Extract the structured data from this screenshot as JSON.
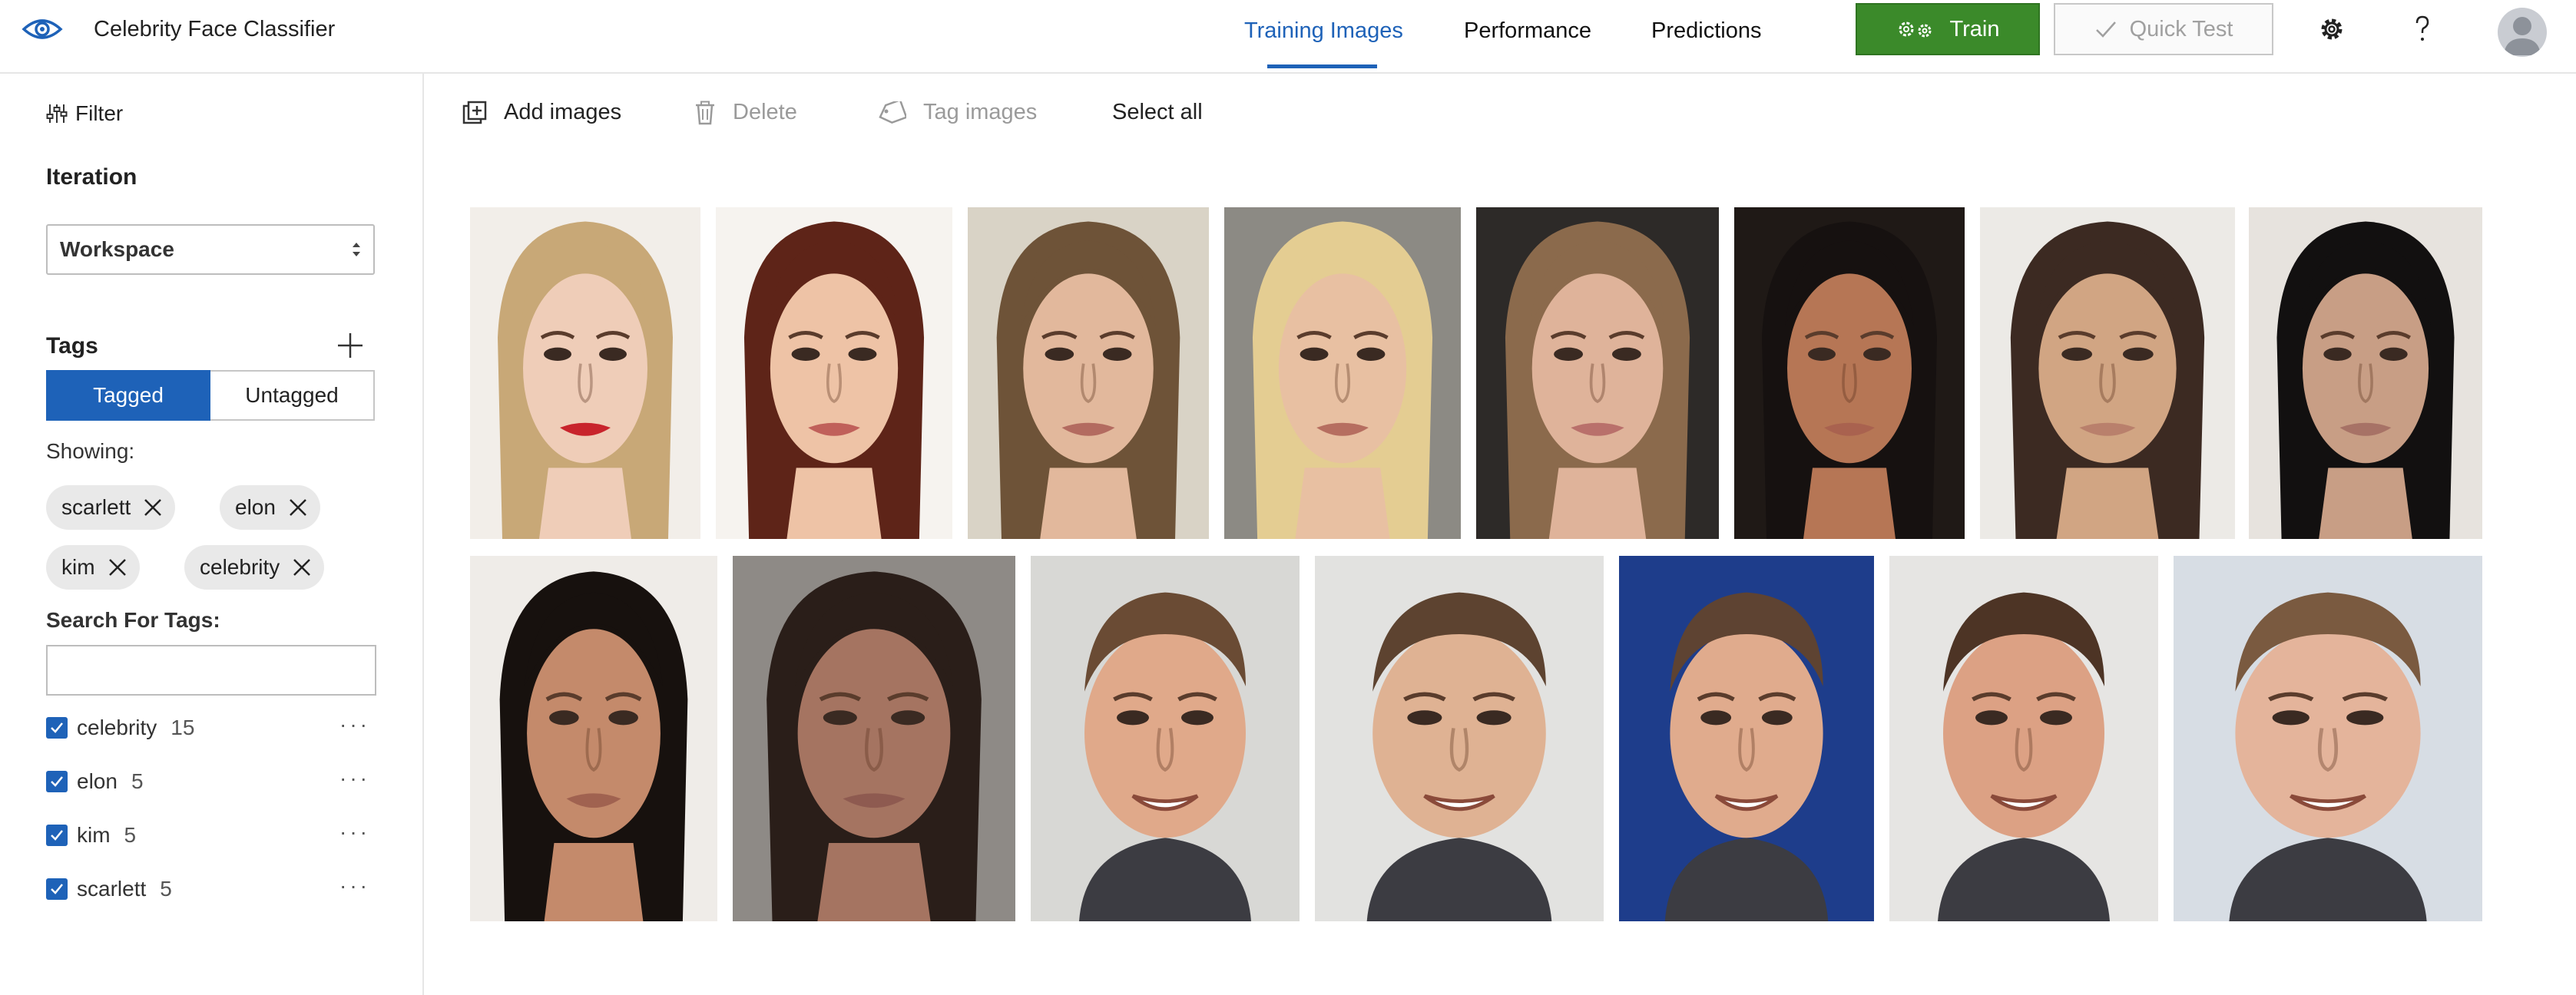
{
  "app": {
    "title": "Celebrity Face Classifier"
  },
  "nav": {
    "tabs": [
      {
        "label": "Training Images",
        "active": true
      },
      {
        "label": "Performance",
        "active": false
      },
      {
        "label": "Predictions",
        "active": false
      }
    ],
    "train_label": "Train",
    "quick_test_label": "Quick Test",
    "icons": [
      "eye-logo-icon",
      "gear-icon",
      "help-icon",
      "avatar"
    ]
  },
  "sidebar": {
    "filter_label": "Filter",
    "iteration_title": "Iteration",
    "iteration_value": "Workspace",
    "tags_title": "Tags",
    "tagged_label": "Tagged",
    "untagged_label": "Untagged",
    "showing_label": "Showing:",
    "chips": [
      "scarlett",
      "elon",
      "kim",
      "celebrity"
    ],
    "search_label": "Search For Tags:",
    "search_value": "",
    "tag_list": [
      {
        "name": "celebrity",
        "count": "15",
        "checked": true
      },
      {
        "name": "elon",
        "count": "5",
        "checked": true
      },
      {
        "name": "kim",
        "count": "5",
        "checked": true
      },
      {
        "name": "scarlett",
        "count": "5",
        "checked": true
      }
    ],
    "more_glyph": "···"
  },
  "toolbar": {
    "add_images": "Add images",
    "delete": "Delete",
    "tag_images": "Tag images",
    "select_all": "Select all"
  },
  "colors": {
    "accent": "#1e62b8",
    "train_green": "#3b8a2a"
  },
  "images": [
    {
      "name": "scarlett-1",
      "bg": "#f2eee9",
      "skin": "#efcdb8",
      "hair": "#c8a877",
      "lips": "#c8242c"
    },
    {
      "name": "scarlett-2",
      "bg": "#f6f3ef",
      "skin": "#eec3a6",
      "hair": "#5e2418",
      "lips": "#c0605a"
    },
    {
      "name": "scarlett-3",
      "bg": "#d9d3c6",
      "skin": "#e2b89c",
      "hair": "#6e5338",
      "lips": "#b36b60"
    },
    {
      "name": "scarlett-4",
      "bg": "#8c8a84",
      "skin": "#e8c0a2",
      "hair": "#e4cd92",
      "lips": "#b66e60"
    },
    {
      "name": "scarlett-5",
      "bg": "#2d2a28",
      "skin": "#dfb39a",
      "hair": "#8b6a4c",
      "lips": "#b9706b"
    },
    {
      "name": "kim-1",
      "bg": "#1f1916",
      "skin": "#b67655",
      "hair": "#161110",
      "lips": "#a9624f"
    },
    {
      "name": "kim-2",
      "bg": "#eceae6",
      "skin": "#d1a583",
      "hair": "#3c2a22",
      "lips": "#b9806c"
    },
    {
      "name": "kim-3",
      "bg": "#e7e3de",
      "skin": "#c89e85",
      "hair": "#121010",
      "lips": "#a77266"
    },
    {
      "name": "kim-4",
      "bg": "#efece8",
      "skin": "#c48a6b",
      "hair": "#17110e",
      "lips": "#a06250"
    },
    {
      "name": "kim-5",
      "bg": "#8e8a86",
      "skin": "#a57461",
      "hair": "#2a1e19",
      "lips": "#8e5a50"
    },
    {
      "name": "elon-1",
      "bg": "#d8d8d5",
      "skin": "#e0a98a",
      "hair": "#6a4b34",
      "lips": "#ffffff"
    },
    {
      "name": "elon-2",
      "bg": "#e2e2e0",
      "skin": "#dfb293",
      "hair": "#5d4330",
      "lips": "#ffffff"
    },
    {
      "name": "elon-3",
      "bg": "#1e3d8b",
      "skin": "#e0ab8d",
      "hair": "#5e4332",
      "lips": "#ffffff"
    },
    {
      "name": "elon-4",
      "bg": "#e6e5e3",
      "skin": "#dca184",
      "hair": "#4d3425",
      "lips": "#ffffff"
    },
    {
      "name": "elon-5",
      "bg": "#d7dde4",
      "skin": "#e4b49b",
      "hair": "#7a5a40",
      "lips": "#b57a68"
    }
  ]
}
